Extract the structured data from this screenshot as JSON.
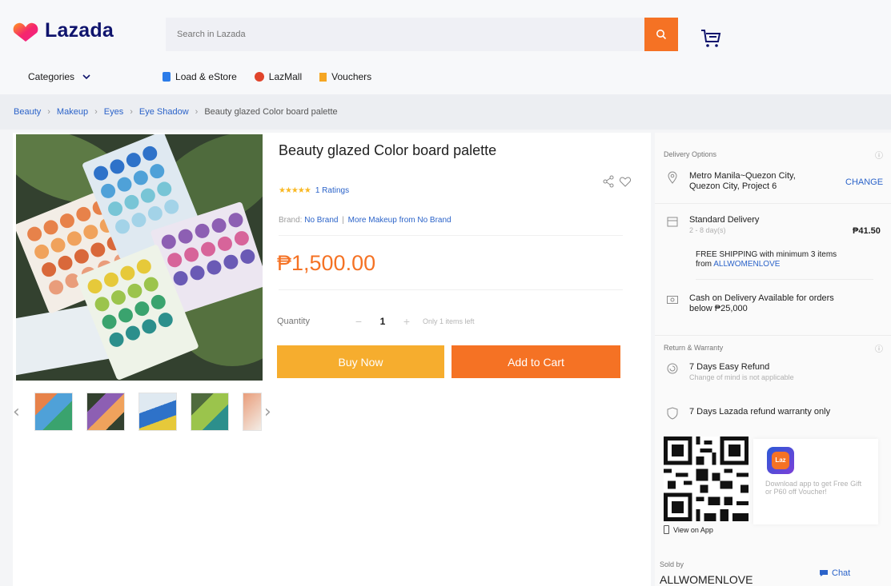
{
  "header": {
    "logo_text": "Lazada",
    "search_placeholder": "Search in Lazada",
    "nav": {
      "categories": "Categories",
      "items": [
        {
          "label": "Load & eStore",
          "icon": "load-icon"
        },
        {
          "label": "LazMall",
          "icon": "lazmall-icon"
        },
        {
          "label": "Vouchers",
          "icon": "voucher-icon"
        }
      ]
    }
  },
  "breadcrumb": [
    "Beauty",
    "Makeup",
    "Eyes",
    "Eye Shadow",
    "Beauty glazed Color board palette"
  ],
  "product": {
    "title": "Beauty glazed Color board palette",
    "stars": "★★★★★",
    "ratings": "1 Ratings",
    "brand_label": "Brand:",
    "brand": "No Brand",
    "brand_separator": "|",
    "more_from": "More Makeup from No Brand",
    "price": "₱1,500.00",
    "quantity_label": "Quantity",
    "quantity": "1",
    "minus": "−",
    "plus": "+",
    "stock_note": "Only 1 items left",
    "buy_now": "Buy Now",
    "add_to_cart": "Add to Cart"
  },
  "delivery": {
    "section_title": "Delivery Options",
    "location_line1": "Metro Manila~Quezon City,",
    "location_line2": "Quezon City, Project 6",
    "change": "CHANGE",
    "standard": "Standard Delivery",
    "days": "2 - 8 day(s)",
    "fee": "₱41.50",
    "free_shipping_line1": "FREE SHIPPING with minimum 3 items",
    "free_from": "from",
    "free_shop": "ALLWOMENLOVE",
    "cod_line1": "Cash on Delivery Available for orders",
    "cod_line2": "below ₱25,000"
  },
  "warranty": {
    "section_title": "Return & Warranty",
    "refund": "7 Days Easy Refund",
    "refund_note": "Change of mind is not applicable",
    "lazada_refund": "7 Days Lazada refund warranty only"
  },
  "app": {
    "logo_text": "Laz",
    "promo": "Download app to get Free Gift or P60 off Voucher!",
    "view_on_app": "View on App"
  },
  "seller": {
    "sold_by": "Sold by",
    "name": "ALLWOMENLOVE",
    "chat": "Chat"
  },
  "colors": {
    "brand_orange": "#f57224",
    "buy_now": "#f6ad2e",
    "link_blue": "#2b63c9",
    "logo_navy": "#0f146d"
  }
}
